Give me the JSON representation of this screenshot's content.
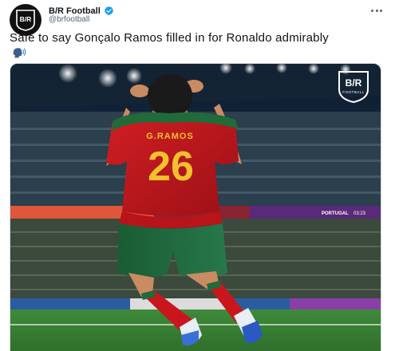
{
  "account": {
    "display_name": "B/R Football",
    "handle": "@brfootball",
    "avatar_text": "B/R",
    "verified": true
  },
  "tweet": {
    "text": "Safe to say Gonçalo Ramos filled in for Ronaldo admirably",
    "emoji_icon": "speaking-head-icon"
  },
  "media": {
    "jersey_name": "G.RAMOS",
    "jersey_number": "26",
    "watermark_text": "B/R",
    "watermark_subtext": "FOOTBALL",
    "ad_board_text": "PORTUGAL",
    "ad_board_score": "03:23"
  },
  "menu": {
    "icon": "more-options-icon"
  },
  "colors": {
    "text_primary": "#0f1419",
    "text_secondary": "#536471",
    "verified_blue": "#1d9bf0",
    "jersey_red": "#c4161c",
    "jersey_green": "#1f6b3a",
    "number_yellow": "#f2c12e"
  }
}
